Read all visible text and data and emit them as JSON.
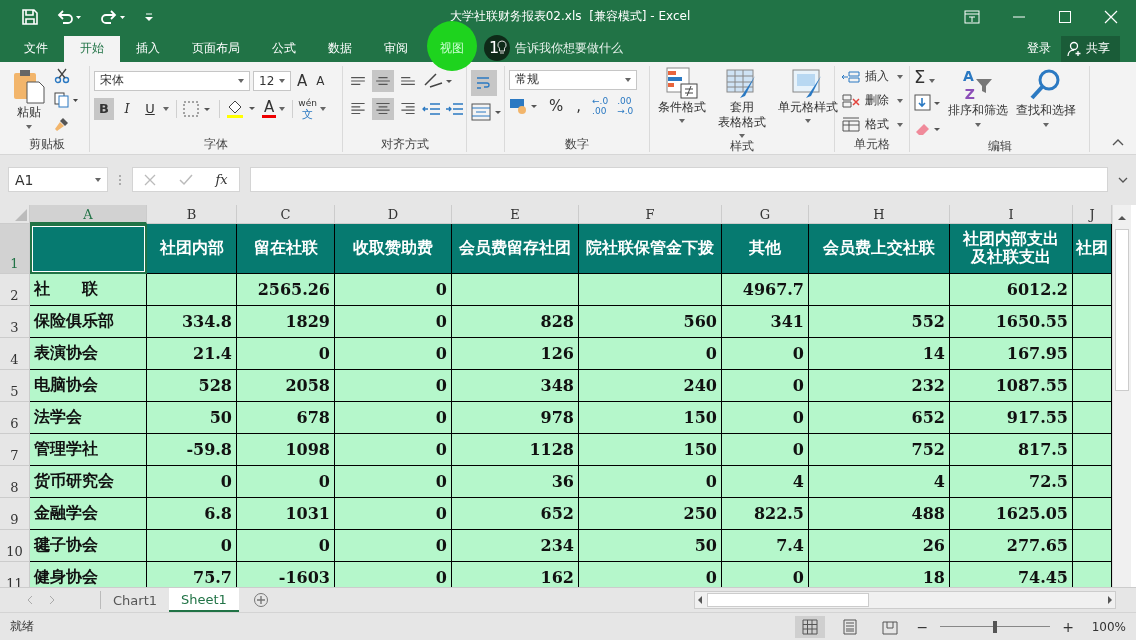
{
  "window": {
    "title": "大学社联财务报表02.xls  [兼容模式] - Excel"
  },
  "menu_tabs": [
    {
      "label": "文件",
      "selected": false,
      "highlighted": false
    },
    {
      "label": "开始",
      "selected": true,
      "highlighted": false
    },
    {
      "label": "插入",
      "selected": false,
      "highlighted": false
    },
    {
      "label": "页面布局",
      "selected": false,
      "highlighted": false
    },
    {
      "label": "公式",
      "selected": false,
      "highlighted": false
    },
    {
      "label": "数据",
      "selected": false,
      "highlighted": false
    },
    {
      "label": "审阅",
      "selected": false,
      "highlighted": false
    },
    {
      "label": "视图",
      "selected": false,
      "highlighted": true
    }
  ],
  "step_badge": "1",
  "tell_me": {
    "placeholder": "告诉我你想要做什么"
  },
  "sign_in": "登录",
  "share": "共享",
  "ribbon": {
    "clipboard": {
      "paste": "粘贴",
      "label": "剪贴板"
    },
    "font": {
      "font_name": "宋体",
      "font_size": "12",
      "grow": "A",
      "shrink": "A",
      "styles": [
        {
          "glyph": "B",
          "selected": true
        },
        {
          "glyph": "I",
          "selected": false
        },
        {
          "glyph": "U",
          "selected": false
        }
      ],
      "font_color": "A",
      "phonetic": [
        "wén",
        "文"
      ],
      "label": "字体"
    },
    "alignment": {
      "vertical": [
        {
          "kind": "top",
          "selected": false
        },
        {
          "kind": "middle",
          "selected": true
        },
        {
          "kind": "bottom",
          "selected": false
        }
      ],
      "horizontal": [
        {
          "kind": "left",
          "selected": false
        },
        {
          "kind": "center",
          "selected": true
        },
        {
          "kind": "right",
          "selected": false
        }
      ],
      "wrap": {
        "selected": true
      },
      "label": "对齐方式"
    },
    "number": {
      "format": "常规",
      "percent": "%",
      "comma": ",",
      "increase_decimal": [
        "←.0",
        ".00"
      ],
      "decrease_decimal": [
        ".00",
        "→.0"
      ],
      "label": "数字"
    },
    "styles": {
      "buttons": [
        {
          "kind": "conditional",
          "label": [
            "条件格式"
          ]
        },
        {
          "kind": "table",
          "label": [
            "套用",
            "表格格式"
          ]
        },
        {
          "kind": "cell",
          "label": [
            "单元格样式"
          ]
        }
      ],
      "label": "样式"
    },
    "cells": {
      "buttons": [
        {
          "kind": "insert",
          "label": "插入"
        },
        {
          "kind": "delete",
          "label": "删除"
        },
        {
          "kind": "format",
          "label": "格式"
        }
      ],
      "label": "单元格"
    },
    "editing": {
      "sum": "Σ",
      "sort_glyphs": [
        "A",
        "Z"
      ],
      "sort": "排序和筛选",
      "find": "查找和选择",
      "label": "编辑"
    }
  },
  "formula_bar": {
    "name_box": "A1",
    "fx": "fx"
  },
  "columns": [
    {
      "letter": "A",
      "selected": true
    },
    {
      "letter": "B",
      "selected": false
    },
    {
      "letter": "C",
      "selected": false
    },
    {
      "letter": "D",
      "selected": false
    },
    {
      "letter": "E",
      "selected": false
    },
    {
      "letter": "F",
      "selected": false
    },
    {
      "letter": "G",
      "selected": false
    },
    {
      "letter": "H",
      "selected": false
    },
    {
      "letter": "I",
      "selected": false
    },
    {
      "letter": "J",
      "selected": false
    }
  ],
  "rows": [
    {
      "number": "1",
      "kind": "header",
      "selected": true,
      "cells": [
        null,
        "社团内部",
        "留在社联",
        "收取赞助费",
        "会员费留存社团",
        "院社联保管金下拨",
        "其他",
        "会员费上交社联",
        "社团内部支出及社联支出",
        "社团"
      ]
    },
    {
      "number": "2",
      "kind": "data",
      "selected": false,
      "cells": [
        "社　　联",
        null,
        "2565.26",
        "0",
        null,
        null,
        "4967.7",
        null,
        "6012.2",
        null
      ]
    },
    {
      "number": "3",
      "kind": "data",
      "selected": false,
      "cells": [
        "保险俱乐部",
        "334.8",
        "1829",
        "0",
        "828",
        "560",
        "341",
        "552",
        "1650.55",
        null
      ]
    },
    {
      "number": "4",
      "kind": "data",
      "selected": false,
      "cells": [
        "表演协会",
        "21.4",
        "0",
        "0",
        "126",
        "0",
        "0",
        "14",
        "167.95",
        null
      ]
    },
    {
      "number": "5",
      "kind": "data",
      "selected": false,
      "cells": [
        "电脑协会",
        "528",
        "2058",
        "0",
        "348",
        "240",
        "0",
        "232",
        "1087.55",
        null
      ]
    },
    {
      "number": "6",
      "kind": "data",
      "selected": false,
      "cells": [
        "法学会",
        "50",
        "678",
        "0",
        "978",
        "150",
        "0",
        "652",
        "917.55",
        null
      ]
    },
    {
      "number": "7",
      "kind": "data",
      "selected": false,
      "cells": [
        "管理学社",
        "-59.8",
        "1098",
        "0",
        "1128",
        "150",
        "0",
        "752",
        "817.5",
        null
      ]
    },
    {
      "number": "8",
      "kind": "data",
      "selected": false,
      "cells": [
        "货币研究会",
        "0",
        "0",
        "0",
        "36",
        "0",
        "4",
        "4",
        "72.5",
        null
      ]
    },
    {
      "number": "9",
      "kind": "data",
      "selected": false,
      "cells": [
        "金融学会",
        "6.8",
        "1031",
        "0",
        "652",
        "250",
        "822.5",
        "488",
        "1625.05",
        null
      ]
    },
    {
      "number": "10",
      "kind": "data",
      "selected": false,
      "cells": [
        "毽子协会",
        "0",
        "0",
        "0",
        "234",
        "50",
        "7.4",
        "26",
        "277.65",
        null
      ]
    },
    {
      "number": "11",
      "kind": "data",
      "selected": false,
      "cells": [
        "健身协会",
        "75.7",
        "-1603",
        "0",
        "162",
        "0",
        "0",
        "18",
        "74.45",
        null
      ]
    }
  ],
  "sheet_tabs": [
    {
      "label": "Chart1",
      "selected": false
    },
    {
      "label": "Sheet1",
      "selected": true
    }
  ],
  "status": {
    "text": "就绪",
    "views": [
      {
        "kind": "normal",
        "selected": true
      },
      {
        "kind": "page_layout",
        "selected": false
      },
      {
        "kind": "page_break",
        "selected": false
      }
    ],
    "zoom_out": "−",
    "zoom_slider": {
      "level": 0.5
    },
    "zoom_in": "+",
    "zoom": "100%"
  }
}
